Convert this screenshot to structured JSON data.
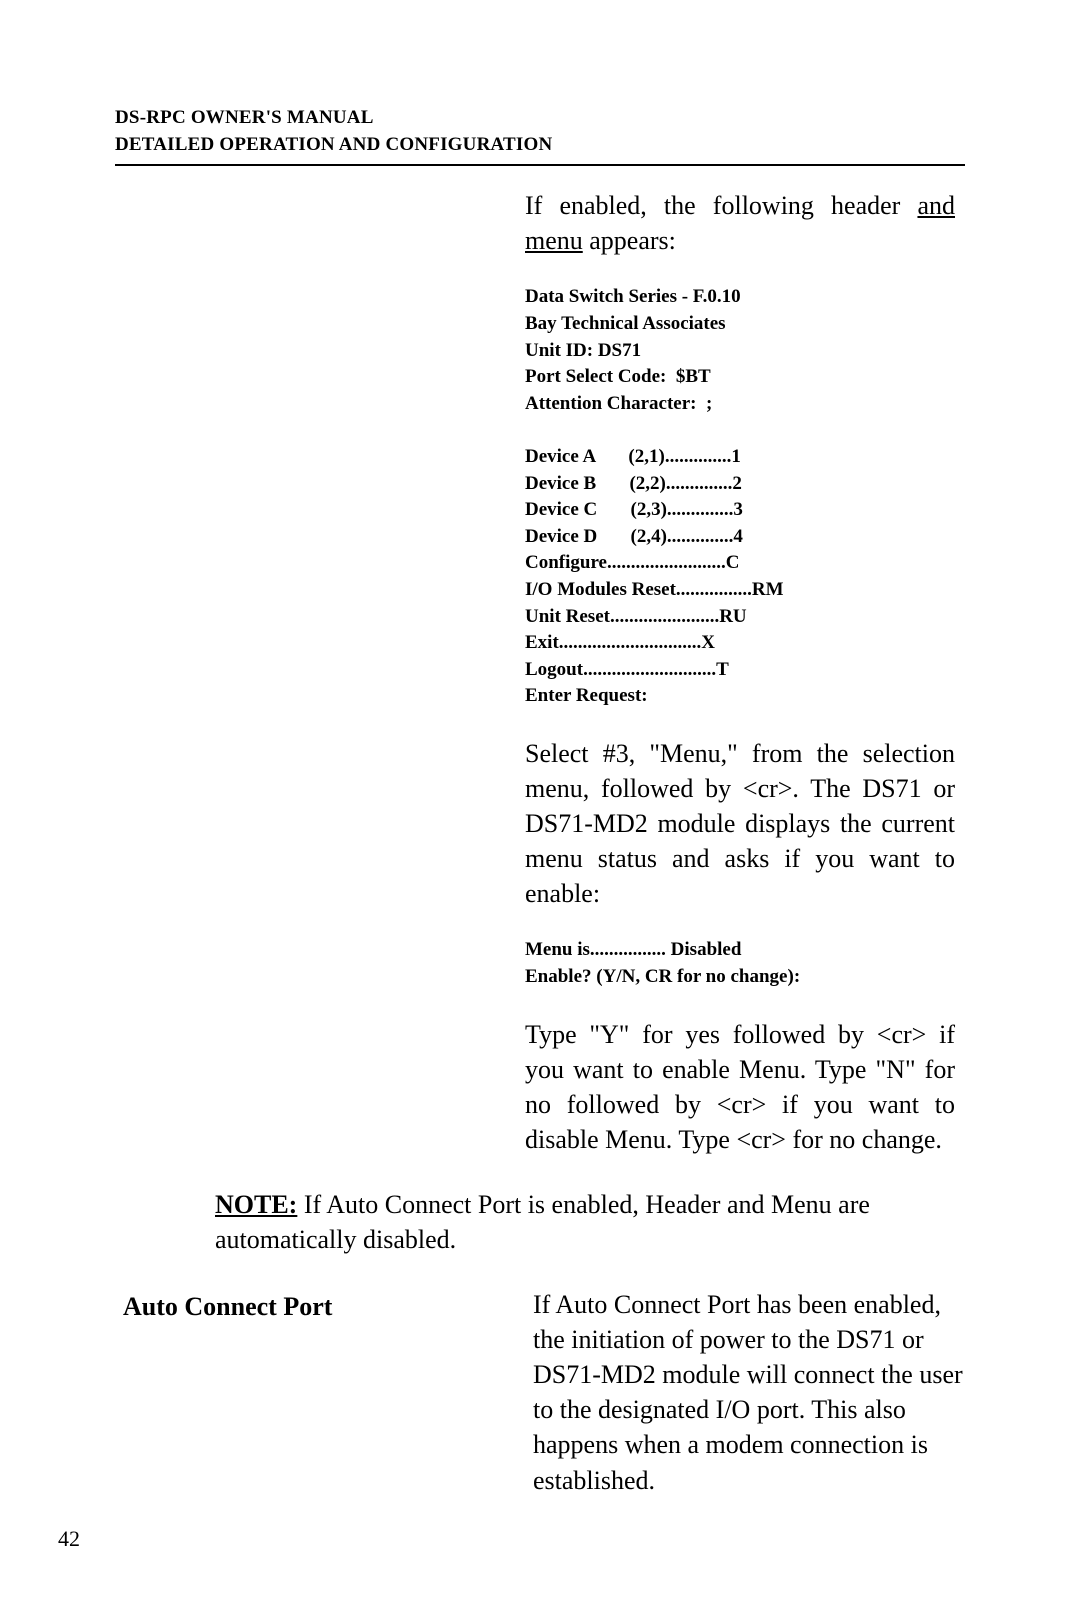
{
  "header": {
    "line1": "DS-RPC OWNER'S MANUAL",
    "line2": "DETAILED OPERATION AND CONFIGURATION"
  },
  "intro": {
    "text_before_underline": "If enabled, the following header ",
    "underlined": "and menu",
    "text_after_underline": " appears:"
  },
  "screen1": {
    "line1": "Data Switch Series - F.0.10",
    "line2": "Bay Technical Associates",
    "line3_a": "Unit ID",
    "line3_b": ": DS71",
    "line4": "Port Select Code:  $BT",
    "line5": "Attention Character:  ;",
    "menu": [
      {
        "label": "Device A",
        "coord": "(2,1)",
        "key": "1"
      },
      {
        "label": "Device B",
        "coord": "(2,2)",
        "key": "2"
      },
      {
        "label": "Device C",
        "coord": "(2,3)",
        "key": "3"
      },
      {
        "label": "Device D",
        "coord": "(2,4)",
        "key": "4"
      }
    ],
    "menu2": [
      {
        "label": "Configure",
        "key": "C"
      },
      {
        "label": "I/O Modules Reset",
        "key": "RM"
      },
      {
        "label": "Unit Reset",
        "key": "RU"
      },
      {
        "label": "Exit",
        "key": "X"
      },
      {
        "label": "Logout",
        "key": "T"
      }
    ],
    "prompt": "Enter Request:"
  },
  "para2": "Select #3, \"Menu,\" from the selection menu, followed by <cr>. The DS71 or DS71-MD2 module  displays the current menu status and asks if you want to enable:",
  "screen2": {
    "line1_a": "Menu  is",
    "line1_b": "Disabled",
    "line2": "Enable? (Y/N, CR for no change):"
  },
  "para3": "Type \"Y\" for yes followed by <cr>  if you want to enable Menu. Type  \"N\" for no followed by <cr> if you want to disable Menu. Type <cr> for  no change.",
  "note": {
    "label": "NOTE:",
    "text": " If Auto Connect Port is enabled, Header and Menu are automatically disabled."
  },
  "section": {
    "heading": "Auto Connect Port",
    "body": "If Auto Connect Port has been enabled, the initiation of power to the DS71 or DS71-MD2 module will connect the user to the designated I/O port. This also happens when a modem connection is established."
  },
  "pagenum": "42"
}
